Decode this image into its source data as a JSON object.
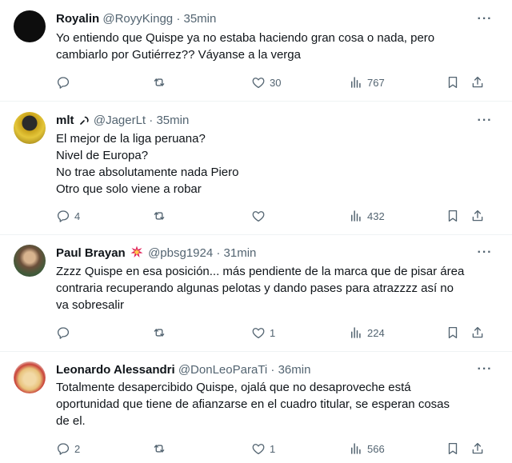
{
  "tweets": [
    {
      "name": "Royalin",
      "handle": "@RoyyKingg",
      "separator": "·",
      "time": "35min",
      "lines": [
        "Yo entiendo que Quispe ya no estaba haciendo gran cosa o nada, pero",
        "cambiarlo por Gutiérrez?? Váyanse a la verga"
      ],
      "replies": "",
      "retweets": "",
      "likes": "30",
      "views": "767"
    },
    {
      "name": "mlt",
      "handle": "@JagerLt",
      "separator": "·",
      "time": "35min",
      "lines": [
        "El mejor de la liga peruana?",
        "Nivel de Europa?",
        "No trae absolutamente nada Piero",
        "Otro que solo viene a robar"
      ],
      "replies": "4",
      "retweets": "",
      "likes": "",
      "views": "432"
    },
    {
      "name": "Paul Brayan",
      "handle": "@pbsg1924",
      "separator": "·",
      "time": "31min",
      "lines": [
        "Zzzz Quispe en esa posición... más pendiente de la marca que de pisar área",
        "contraria recuperando algunas pelotas y dando pases para atrazzzz así no",
        "va sobresalir"
      ],
      "replies": "",
      "retweets": "",
      "likes": "1",
      "views": "224"
    },
    {
      "name": "Leonardo Alessandri",
      "handle": "@DonLeoParaTi",
      "separator": "·",
      "time": "36min",
      "lines": [
        "Totalmente desapercibido Quispe, ojalá que no desaproveche está",
        "oportunidad que tiene de afianzarse en el cuadro titular, se esperan cosas",
        "de el."
      ],
      "replies": "2",
      "retweets": "",
      "likes": "1",
      "views": "566"
    }
  ],
  "icons": {
    "more": "more-horizontal-icon",
    "reply": "reply-icon",
    "retweet": "retweet-icon",
    "like": "heart-icon",
    "views": "views-bar-chart-icon",
    "bookmark": "bookmark-icon",
    "share": "share-icon"
  },
  "colors": {
    "text": "#0f1419",
    "muted": "#536471",
    "divider": "#eff3f4",
    "badge": "#e0245e"
  }
}
